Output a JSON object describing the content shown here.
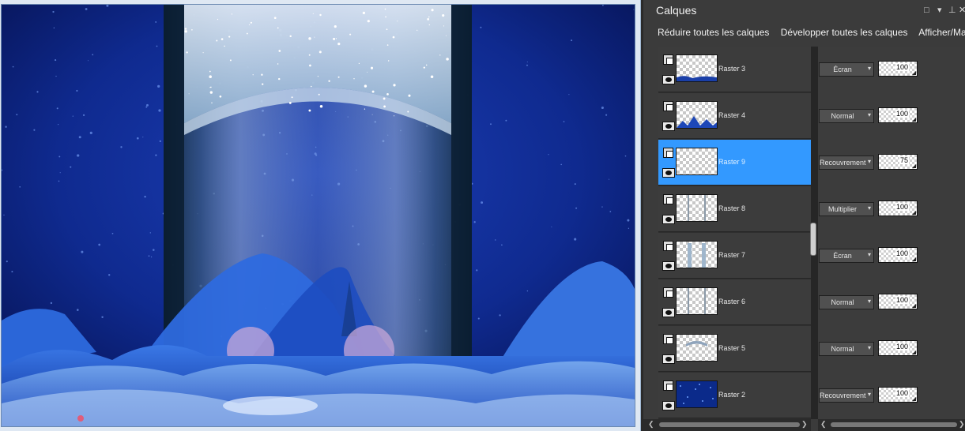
{
  "panel": {
    "title": "Calques",
    "controls": {
      "float_icon": "restore-window-icon",
      "menu_icon": "dropdown-arrow-icon",
      "pin_icon": "pin-icon",
      "close_icon": "close-icon"
    },
    "toolbar": {
      "collapse_all": "Réduire toutes les calques",
      "expand_all": "Développer toutes les calques",
      "show_mask": "Afficher/Masquer"
    }
  },
  "layers": [
    {
      "name": "Raster 3",
      "blend": "Écran",
      "opacity": "100",
      "selected": false,
      "thumb": "mountains-bottom"
    },
    {
      "name": "Raster 4",
      "blend": "Normal",
      "opacity": "100",
      "selected": false,
      "thumb": "peaks"
    },
    {
      "name": "Raster 9",
      "blend": "Recouvrement",
      "opacity": "75",
      "selected": true,
      "thumb": "empty"
    },
    {
      "name": "Raster 8",
      "blend": "Multiplier",
      "opacity": "100",
      "selected": false,
      "thumb": "lines"
    },
    {
      "name": "Raster 7",
      "blend": "Écran",
      "opacity": "100",
      "selected": false,
      "thumb": "pillar"
    },
    {
      "name": "Raster 6",
      "blend": "Normal",
      "opacity": "100",
      "selected": false,
      "thumb": "lines"
    },
    {
      "name": "Raster 5",
      "blend": "Normal",
      "opacity": "100",
      "selected": false,
      "thumb": "arch"
    },
    {
      "name": "Raster 2",
      "blend": "Recouvrement",
      "opacity": "100",
      "selected": false,
      "thumb": "stars"
    }
  ],
  "colors": {
    "panel_bg": "#3c3c3c",
    "selection": "#3399ff",
    "sky_dark": "#06124f",
    "sky_mid": "#1a3ab8",
    "mountain": "#2a62d6"
  }
}
